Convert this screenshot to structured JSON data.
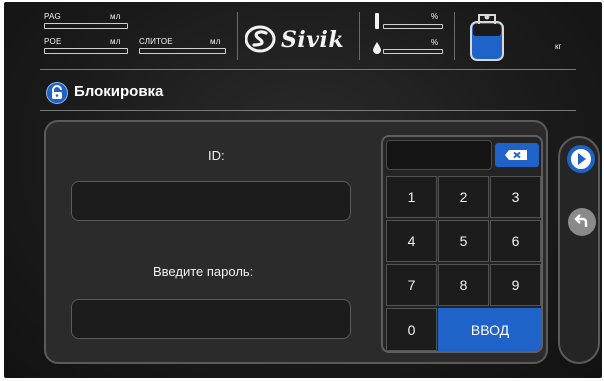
{
  "header": {
    "pag": {
      "label": "PAG",
      "unit": "мл"
    },
    "poe": {
      "label": "POE",
      "unit": "мл"
    },
    "clean": {
      "label": "СЛИТОЕ",
      "unit": "мл"
    },
    "logo_text": "Sivik",
    "dye_pct": "%",
    "water_pct": "%",
    "tank_unit": "кг"
  },
  "page": {
    "title": "Блокировка"
  },
  "form": {
    "id_label": "ID:",
    "id_value": "",
    "password_label": "Введите пароль:",
    "password_value": ""
  },
  "keypad": {
    "display": "",
    "keys": [
      "1",
      "2",
      "3",
      "4",
      "5",
      "6",
      "7",
      "8",
      "9",
      "0"
    ],
    "enter_label": "ВВОД"
  },
  "colors": {
    "accent": "#1f63c8",
    "background": "#1a1a1a"
  },
  "icons": {
    "lock": "lock-icon",
    "backspace": "backspace-icon",
    "next": "play-icon",
    "back": "undo-icon"
  }
}
